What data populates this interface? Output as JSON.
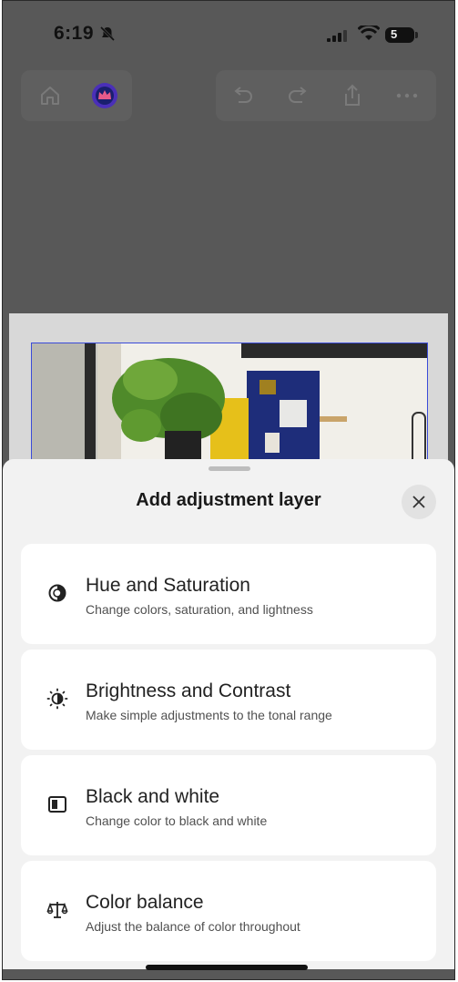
{
  "status_bar": {
    "time": "6:19",
    "battery_level": "5"
  },
  "toolbar": {
    "left_icons": [
      "home-icon",
      "premium-crown-icon"
    ],
    "right_icons": [
      "undo-icon",
      "redo-icon",
      "share-icon",
      "more-icon"
    ]
  },
  "sheet": {
    "title": "Add adjustment layer",
    "items": [
      {
        "icon": "hue-saturation-icon",
        "title": "Hue and Saturation",
        "subtitle": "Change colors, saturation, and lightness"
      },
      {
        "icon": "brightness-contrast-icon",
        "title": "Brightness and Contrast",
        "subtitle": "Make simple adjustments to the tonal range"
      },
      {
        "icon": "black-white-icon",
        "title": "Black and white",
        "subtitle": "Change color to black and white"
      },
      {
        "icon": "color-balance-icon",
        "title": "Color balance",
        "subtitle": "Adjust the balance of color throughout"
      }
    ]
  },
  "colors": {
    "overlay": "#585858",
    "sheet_bg": "#f2f2f2",
    "card_bg": "#ffffff",
    "selection_border": "#3b4bd8",
    "crown_badge": "#4a2fb8"
  }
}
